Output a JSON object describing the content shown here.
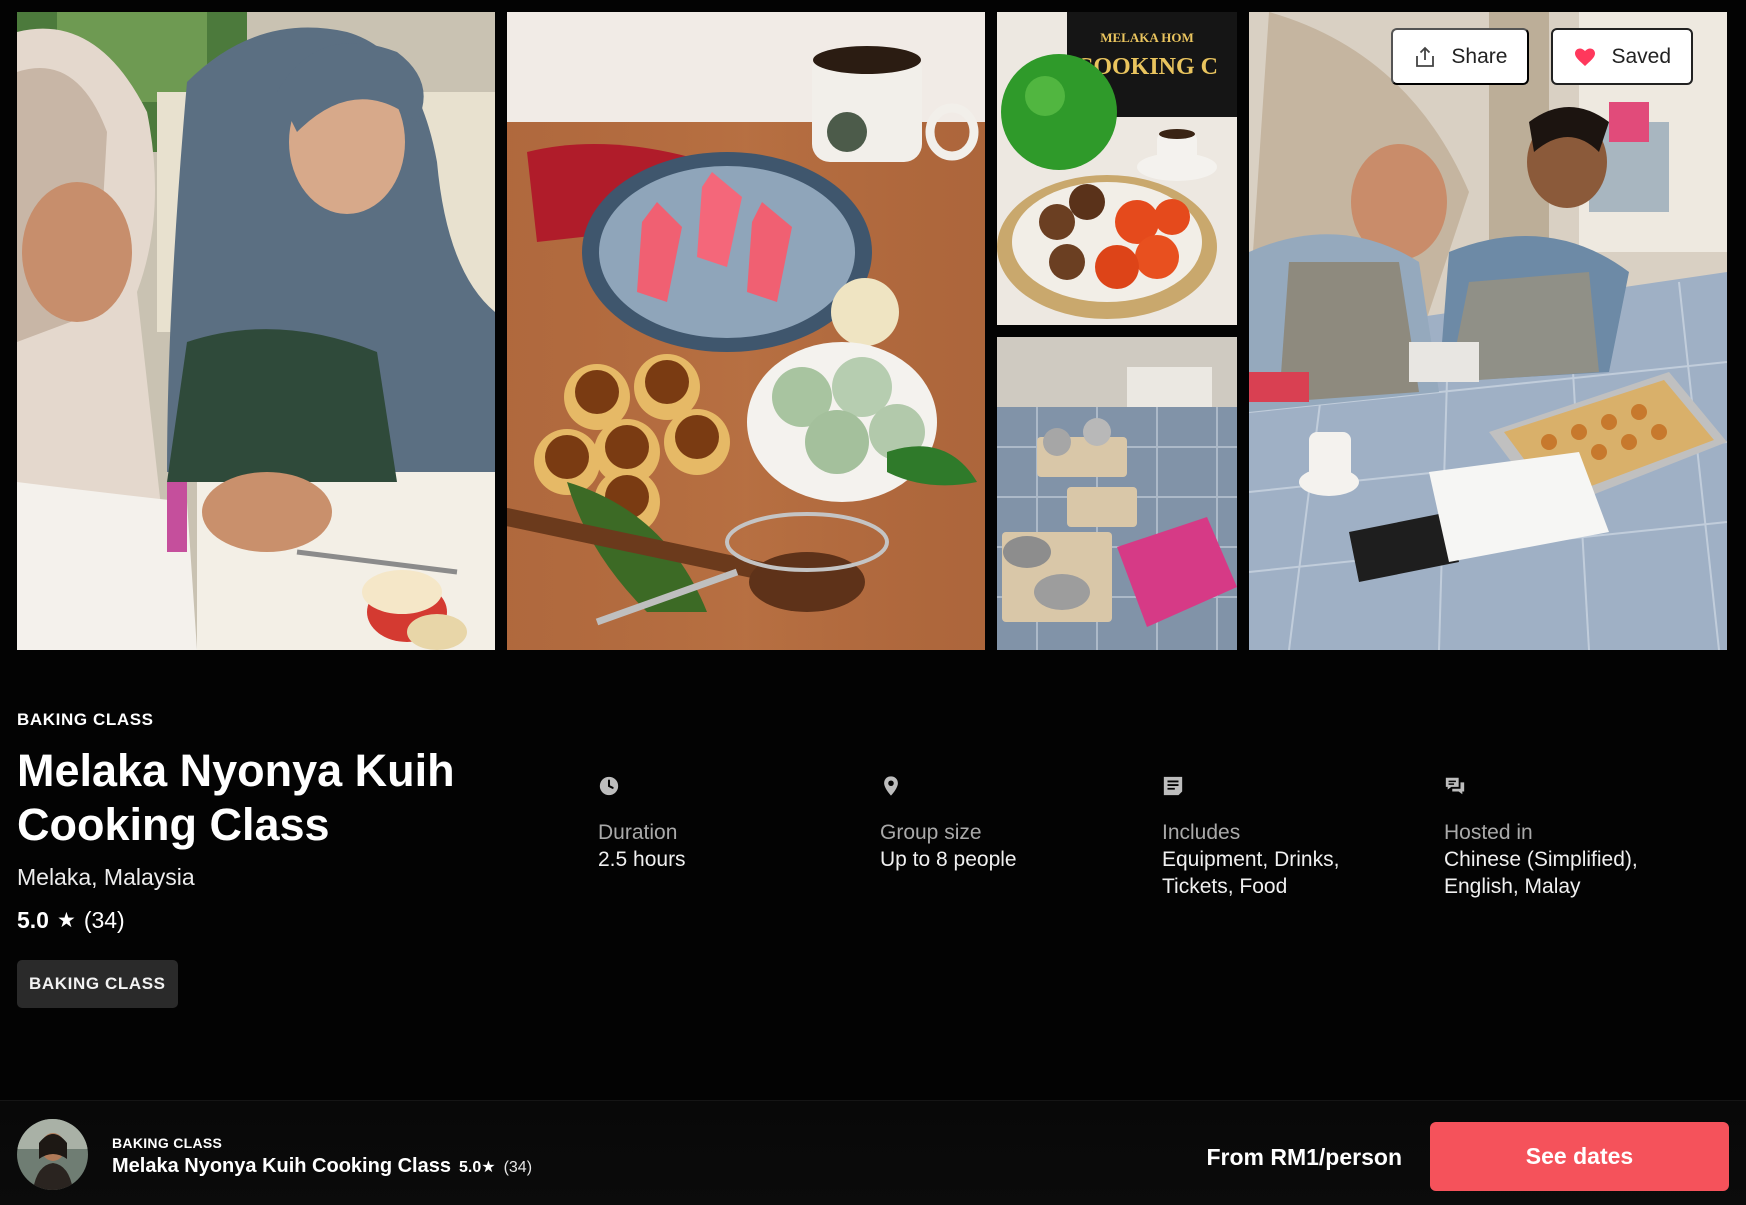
{
  "gallery": {
    "share_label": "Share",
    "saved_label": "Saved",
    "sign_line1": "MELAKA HOM",
    "sign_line2": "COOKING C"
  },
  "experience": {
    "category": "BAKING CLASS",
    "title": "Melaka Nyonya Kuih Cooking Class",
    "location": "Melaka, Malaysia",
    "rating": "5.0",
    "star": "★",
    "reviews": "(34)",
    "tag": "BAKING CLASS"
  },
  "facts": [
    {
      "icon": "clock-icon",
      "label": "Duration",
      "value": "2.5 hours"
    },
    {
      "icon": "location-pin-icon",
      "label": "Group size",
      "value": "Up to 8 people"
    },
    {
      "icon": "document-icon",
      "label": "Includes",
      "value": "Equipment, Drinks, Tickets, Food"
    },
    {
      "icon": "chat-bubbles-icon",
      "label": "Hosted in",
      "value": "Chinese (Simplified), English, Malay"
    }
  ],
  "footer": {
    "category": "BAKING CLASS",
    "title": "Melaka Nyonya Kuih Cooking Class",
    "rating": "5.0",
    "star": "★",
    "reviews": "(34)",
    "price": "From RM1/person",
    "cta": "See dates"
  },
  "colors": {
    "background": "#030303",
    "accent": "#f5525b",
    "heart": "#ff385c"
  }
}
